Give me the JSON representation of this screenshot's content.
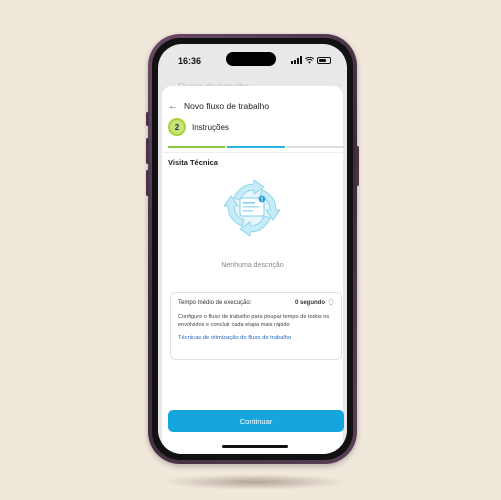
{
  "status_bar": {
    "time": "16:36"
  },
  "background_hint": "Fluxos de trabalho",
  "header": {
    "back_icon": "arrow-left-icon",
    "title": "Novo fluxo de trabalho"
  },
  "step": {
    "number": "2",
    "label": "Instruções"
  },
  "progress": {
    "segments": [
      "#8cc63f",
      "#29b6e0",
      "#dcdcdc"
    ]
  },
  "section": {
    "title": "Visita Técnica"
  },
  "empty_state": {
    "illustration_icon": "cycle-document-icon",
    "text": "Nenhuma descrição"
  },
  "info_card": {
    "label": "Tempo médio de execução:",
    "value": "0 segundo",
    "value_icon": "lightbulb-icon",
    "description": "Configure o fluxo de trabalho para poupar tempo de todos os envolvidos e concluir cada etapa mais rápido",
    "link": "Técnicas de otimização do fluxo de trabalho"
  },
  "actions": {
    "continue": "Continuar"
  },
  "colors": {
    "primary": "#17a5de",
    "step_accent": "#a6d33a",
    "link": "#1f66c9",
    "background": "#f1e8dc"
  }
}
